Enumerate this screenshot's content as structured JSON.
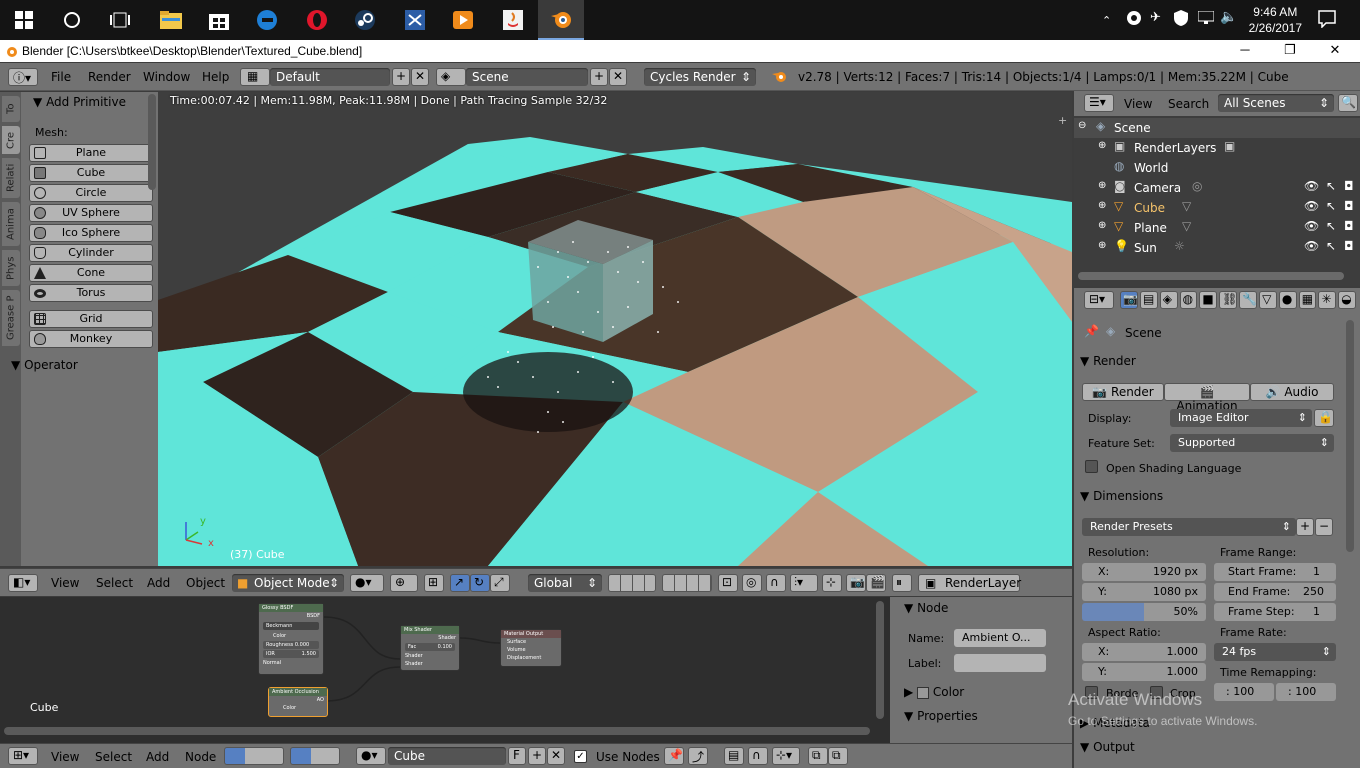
{
  "taskbar": {
    "time": "9:46 AM",
    "date": "2/26/2017"
  },
  "window": {
    "title": "Blender [C:\\Users\\btkee\\Desktop\\Blender\\Textured_Cube.blend]"
  },
  "main_header": {
    "menus": [
      "File",
      "Render",
      "Window",
      "Help"
    ],
    "layout": "Default",
    "scene": "Scene",
    "engine": "Cycles Render",
    "info": "v2.78 | Verts:12 | Faces:7 | Tris:14 | Objects:1/4 | Lamps:0/1 | Mem:35.22M | Cube"
  },
  "tool_panel": {
    "tabs": [
      "To",
      "Cre",
      "Relati",
      "Anima",
      "Phys",
      "Grease P"
    ],
    "section": "Add Primitive",
    "mesh_label": "Mesh:",
    "primitives": [
      "Plane",
      "Cube",
      "Circle",
      "UV Sphere",
      "Ico Sphere",
      "Cylinder",
      "Cone",
      "Torus"
    ],
    "extra": [
      "Grid",
      "Monkey"
    ],
    "operator": "Operator"
  },
  "viewport": {
    "status": "Time:00:07.42 | Mem:11.98M, Peak:11.98M | Done | Path Tracing Sample 32/32",
    "object_label": "(37) Cube",
    "axis_y": "y",
    "axis_x": "x",
    "colors": {
      "cyan": "#5ee4d8",
      "brown": "#3b2a22",
      "tan": "#c49a7e"
    }
  },
  "viewport_header": {
    "menus": [
      "View",
      "Select",
      "Add",
      "Object"
    ],
    "mode": "Object Mode",
    "orientation": "Global",
    "render_layer": "RenderLayer"
  },
  "node_editor": {
    "object_label": "Cube",
    "nodes": {
      "glossy": {
        "title": "Glossy BSDF",
        "output": "BSDF",
        "dist": "Beckmann",
        "color": "Color",
        "rough": "Roughness 0.000",
        "ior": "IOR",
        "ior_val": "1.500",
        "normal": "Normal"
      },
      "mix": {
        "title": "Mix Shader",
        "output": "Shader",
        "fac": "Fac",
        "fac_val": "0.100",
        "in1": "Shader",
        "in2": "Shader"
      },
      "out": {
        "title": "Material Output",
        "surface": "Surface",
        "volume": "Volume",
        "disp": "Displacement"
      },
      "ao": {
        "title": "Ambient Occlusion",
        "output": "AO",
        "color": "Color"
      }
    },
    "side": {
      "node_section": "Node",
      "name_label": "Name:",
      "name_value": "Ambient O...",
      "label_label": "Label:",
      "color_section": "Color",
      "properties_section": "Properties"
    }
  },
  "node_header": {
    "menus": [
      "View",
      "Select",
      "Add",
      "Node"
    ],
    "material": "Cube",
    "fake_user": "F",
    "use_nodes": "Use Nodes"
  },
  "outliner": {
    "menus": [
      "View",
      "Search"
    ],
    "filter": "All Scenes",
    "items": [
      {
        "label": "Scene"
      },
      {
        "label": "RenderLayers"
      },
      {
        "label": "World"
      },
      {
        "label": "Camera"
      },
      {
        "label": "Cube"
      },
      {
        "label": "Plane"
      },
      {
        "label": "Sun"
      }
    ]
  },
  "properties": {
    "context": "Scene",
    "render_section": "Render",
    "render_btn": "Render",
    "animation_btn": "Animation",
    "audio_btn": "Audio",
    "display_label": "Display:",
    "display_value": "Image Editor",
    "feature_label": "Feature Set:",
    "feature_value": "Supported",
    "osl_label": "Open Shading Language",
    "dimensions_section": "Dimensions",
    "presets": "Render Presets",
    "resolution_label": "Resolution:",
    "res_x_label": "X:",
    "res_x": "1920 px",
    "res_y_label": "Y:",
    "res_y": "1080 px",
    "res_pct": "50%",
    "frame_range_label": "Frame Range:",
    "start_label": "Start Frame:",
    "start_value": "1",
    "end_label": "End Frame:",
    "end_value": "250",
    "step_label": "Frame Step:",
    "step_value": "1",
    "aspect_label": "Aspect Ratio:",
    "asp_x_label": "X:",
    "asp_x": "1.000",
    "asp_y_label": "Y:",
    "asp_y": "1.000",
    "frame_rate_label": "Frame Rate:",
    "frame_rate": "24 fps",
    "remap_label": "Time Remapping:",
    "remap_old": ": 100",
    "remap_new": ": 100",
    "border_label": "Borde",
    "crop_label": "Crop",
    "metadata_section": "Metadata",
    "output_section": "Output",
    "watermark_1": "Activate Windows",
    "watermark_2": "Go to Settings to activate Windows."
  }
}
